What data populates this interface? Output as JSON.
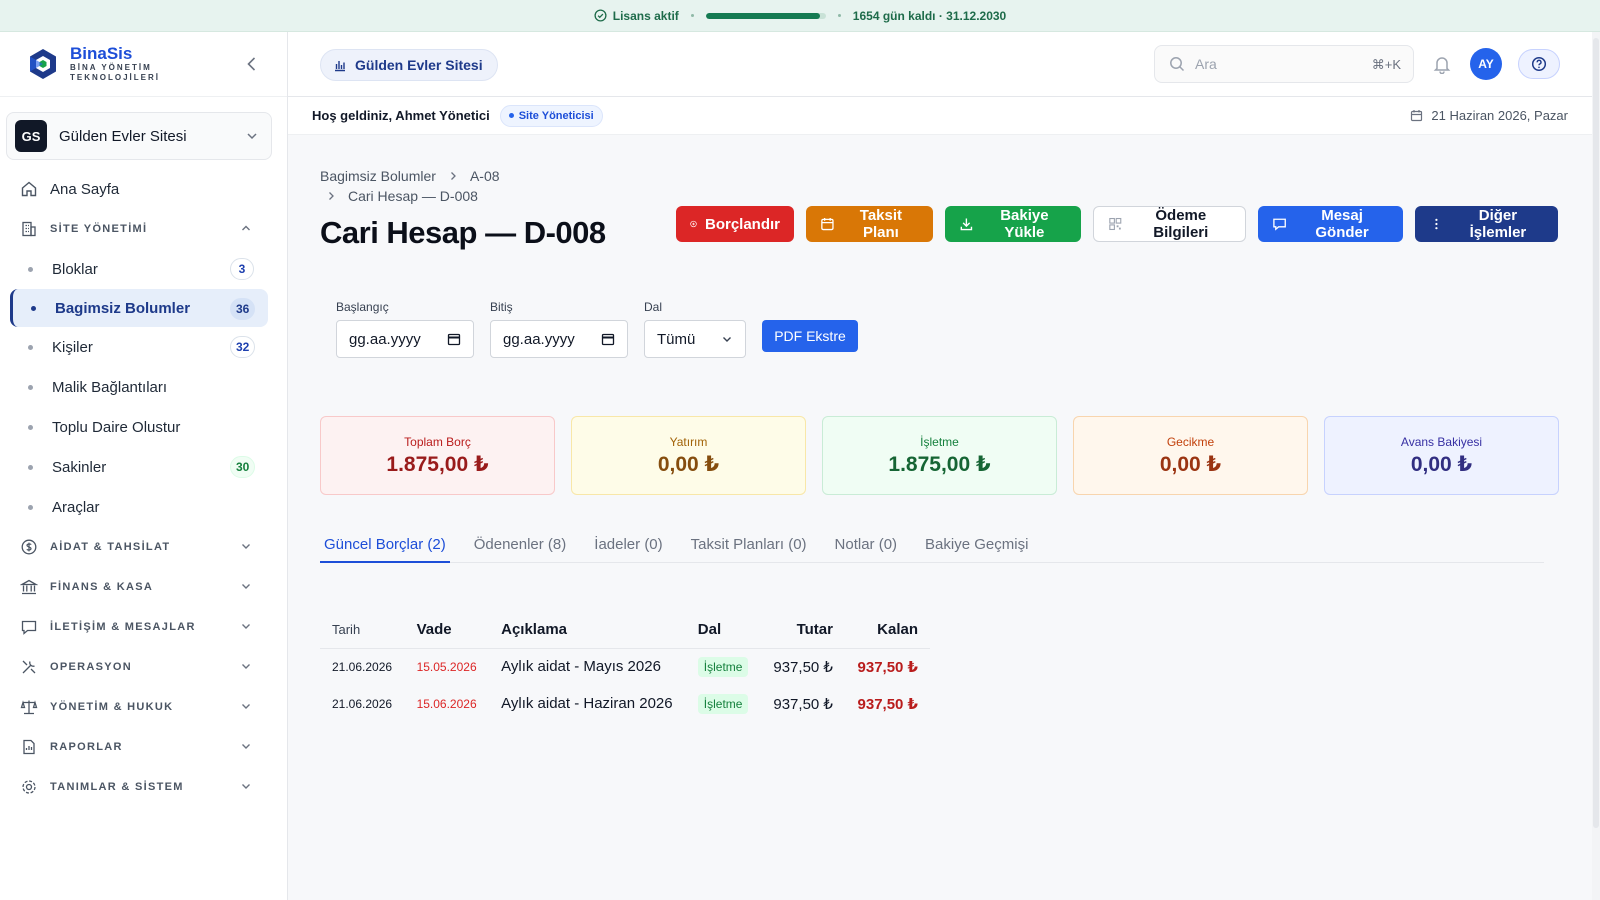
{
  "license": {
    "status": "Lisans aktif",
    "progress": 0.95,
    "remaining": "1654 gün kaldı · 31.12.2030"
  },
  "brand": {
    "name": "BinaSis",
    "tagline_1": "BİNA YÖNETİM",
    "tagline_2": "TEKNOLOJİLERİ"
  },
  "site_selector": {
    "initials": "GS",
    "name": "Gülden Evler Sitesi"
  },
  "nav": {
    "home": "Ana Sayfa",
    "site_group": "SİTE YÖNETİMİ",
    "site_items": [
      {
        "label": "Bloklar",
        "count": "3"
      },
      {
        "label": "Bagimsiz Bolumler",
        "count": "36"
      },
      {
        "label": "Kişiler",
        "count": "32"
      },
      {
        "label": "Malik Bağlantıları"
      },
      {
        "label": "Toplu Daire Olustur"
      },
      {
        "label": "Sakinler",
        "count": "30"
      },
      {
        "label": "Araçlar"
      }
    ],
    "groups": [
      "AİDAT & TAHSİLAT",
      "FİNANS & KASA",
      "İLETİŞİM & MESAJLAR",
      "OPERASYON",
      "YÖNETİM & HUKUK",
      "RAPORLAR",
      "TANIMLAR & SİSTEM"
    ]
  },
  "topbar": {
    "site_pill": "Gülden Evler Sitesi",
    "search_placeholder": "Ara",
    "search_shortcut": "⌘+K",
    "avatar": "AY"
  },
  "welcome": {
    "greeting": "Hoş geldiniz, Ahmet Yönetici",
    "role": "Site Yöneticisi",
    "date": "21 Haziran 2026, Pazar"
  },
  "breadcrumb": {
    "root": "Bagimsiz Bolumler",
    "unit": "A-08",
    "current": "Cari Hesap — D-008"
  },
  "page_title": "Cari Hesap — D-008",
  "actions": {
    "charge": "Borçlandır",
    "installment": "Taksit Planı",
    "load_balance": "Bakiye Yükle",
    "payment_info": "Ödeme Bilgileri",
    "send_message": "Mesaj Gönder",
    "more": "Diğer İşlemler"
  },
  "filters": {
    "start_label": "Başlangıç",
    "start_value": "gg.aa.yyyy",
    "end_label": "Bitiş",
    "end_value": "gg.aa.yyyy",
    "branch_label": "Dal",
    "branch_value": "Tümü",
    "pdf_button": "PDF Ekstre"
  },
  "summary_cards": [
    {
      "label": "Toplam Borç",
      "value": "1.875,00 ₺"
    },
    {
      "label": "Yatırım",
      "value": "0,00 ₺"
    },
    {
      "label": "İşletme",
      "value": "1.875,00 ₺"
    },
    {
      "label": "Gecikme",
      "value": "0,00 ₺"
    },
    {
      "label": "Avans Bakiyesi",
      "value": "0,00 ₺"
    }
  ],
  "tabs": [
    "Güncel Borçlar (2)",
    "Ödenenler (8)",
    "İadeler (0)",
    "Taksit Planları (0)",
    "Notlar (0)",
    "Bakiye Geçmişi"
  ],
  "table": {
    "headers": {
      "date": "Tarih",
      "due": "Vade",
      "desc": "Açıklama",
      "branch": "Dal",
      "amount": "Tutar",
      "remaining": "Kalan"
    },
    "rows": [
      {
        "date": "21.06.2026",
        "due": "15.05.2026",
        "desc": "Aylık aidat - Mayıs 2026",
        "branch": "İşletme",
        "amount": "937,50 ₺",
        "remaining": "937,50 ₺"
      },
      {
        "date": "21.06.2026",
        "due": "15.06.2026",
        "desc": "Aylık aidat - Haziran 2026",
        "branch": "İşletme",
        "amount": "937,50 ₺",
        "remaining": "937,50 ₺"
      }
    ]
  },
  "colors": {
    "primary": "#2563eb",
    "navy": "#1e3a8a",
    "danger": "#dc2626",
    "warning": "#d97706",
    "success": "#16a34a"
  }
}
